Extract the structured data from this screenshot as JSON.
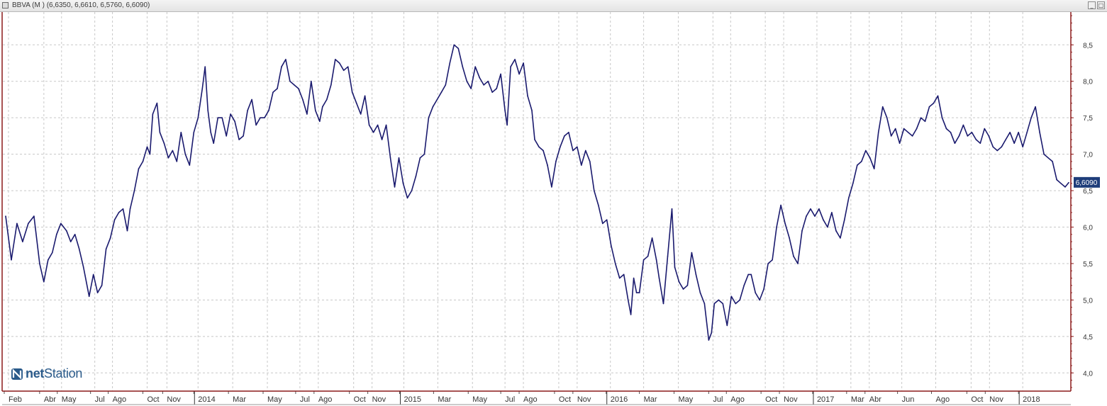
{
  "window": {
    "title": "BBVA (M ) (6,6350, 6,6610, 6,5760, 6,6090)",
    "minimize_glyph": "_",
    "restore_glyph": "□"
  },
  "logo": {
    "text_prefix": "net",
    "text_suffix": "Station"
  },
  "colors": {
    "line": "#1a1a6e",
    "grid": "#c8c8c8",
    "axis_border": "#8b1a1a",
    "price_badge": "#1e3d7a"
  },
  "chart_data": {
    "type": "line",
    "title": "BBVA (M ) (6,6350, 6,6610, 6,5760, 6,6090)",
    "xlabel": "",
    "ylabel": "",
    "ylim": [
      3.75,
      8.95
    ],
    "xlim": [
      0,
      1510
    ],
    "y_ticks": [
      4.0,
      4.5,
      5.0,
      5.5,
      6.0,
      6.5,
      7.0,
      7.5,
      8.0,
      8.5
    ],
    "y_tick_labels": [
      "4,0",
      "4,5",
      "5,0",
      "5,5",
      "6,0",
      "6,5",
      "7,0",
      "7,5",
      "8,0",
      "8,5"
    ],
    "x_ticks": [
      {
        "x": 8,
        "label": "Feb"
      },
      {
        "x": 58,
        "label": "Abr"
      },
      {
        "x": 83,
        "label": "May"
      },
      {
        "x": 130,
        "label": "Jul"
      },
      {
        "x": 155,
        "label": "Ago"
      },
      {
        "x": 204,
        "label": "Oct"
      },
      {
        "x": 232,
        "label": "Nov"
      },
      {
        "x": 276,
        "label": "2014"
      },
      {
        "x": 325,
        "label": "Mar"
      },
      {
        "x": 374,
        "label": "May"
      },
      {
        "x": 420,
        "label": "Jul"
      },
      {
        "x": 446,
        "label": "Ago"
      },
      {
        "x": 496,
        "label": "Oct"
      },
      {
        "x": 522,
        "label": "Nov"
      },
      {
        "x": 567,
        "label": "2015"
      },
      {
        "x": 615,
        "label": "Mar"
      },
      {
        "x": 664,
        "label": "May"
      },
      {
        "x": 710,
        "label": "Jul"
      },
      {
        "x": 736,
        "label": "Ago"
      },
      {
        "x": 786,
        "label": "Oct"
      },
      {
        "x": 812,
        "label": "Nov"
      },
      {
        "x": 859,
        "label": "2016"
      },
      {
        "x": 906,
        "label": "Mar"
      },
      {
        "x": 955,
        "label": "May"
      },
      {
        "x": 1004,
        "label": "Jul"
      },
      {
        "x": 1029,
        "label": "Ago"
      },
      {
        "x": 1078,
        "label": "Oct"
      },
      {
        "x": 1104,
        "label": "Nov"
      },
      {
        "x": 1151,
        "label": "2017"
      },
      {
        "x": 1199,
        "label": "Mar"
      },
      {
        "x": 1225,
        "label": "Abr"
      },
      {
        "x": 1271,
        "label": "Jun"
      },
      {
        "x": 1319,
        "label": "Ago"
      },
      {
        "x": 1369,
        "label": "Oct"
      },
      {
        "x": 1395,
        "label": "Nov"
      },
      {
        "x": 1442,
        "label": "2018"
      }
    ],
    "major_ticks": [
      276,
      567,
      859,
      1151,
      1442
    ],
    "last_price": 6.609,
    "last_price_label": "6,6090",
    "series": [
      {
        "points": [
          [
            4,
            6.15
          ],
          [
            12,
            5.55
          ],
          [
            20,
            6.05
          ],
          [
            28,
            5.8
          ],
          [
            36,
            6.05
          ],
          [
            44,
            6.15
          ],
          [
            52,
            5.5
          ],
          [
            58,
            5.25
          ],
          [
            64,
            5.55
          ],
          [
            70,
            5.65
          ],
          [
            76,
            5.9
          ],
          [
            82,
            6.05
          ],
          [
            90,
            5.95
          ],
          [
            96,
            5.8
          ],
          [
            102,
            5.9
          ],
          [
            108,
            5.7
          ],
          [
            114,
            5.45
          ],
          [
            122,
            5.05
          ],
          [
            128,
            5.35
          ],
          [
            134,
            5.1
          ],
          [
            140,
            5.2
          ],
          [
            146,
            5.7
          ],
          [
            152,
            5.85
          ],
          [
            158,
            6.1
          ],
          [
            164,
            6.2
          ],
          [
            170,
            6.25
          ],
          [
            176,
            5.95
          ],
          [
            180,
            6.25
          ],
          [
            186,
            6.5
          ],
          [
            192,
            6.8
          ],
          [
            198,
            6.9
          ],
          [
            204,
            7.1
          ],
          [
            208,
            7.0
          ],
          [
            212,
            7.55
          ],
          [
            218,
            7.7
          ],
          [
            222,
            7.3
          ],
          [
            228,
            7.15
          ],
          [
            234,
            6.95
          ],
          [
            240,
            7.05
          ],
          [
            246,
            6.9
          ],
          [
            252,
            7.3
          ],
          [
            258,
            7.0
          ],
          [
            264,
            6.85
          ],
          [
            270,
            7.3
          ],
          [
            276,
            7.5
          ],
          [
            282,
            7.9
          ],
          [
            286,
            8.2
          ],
          [
            290,
            7.6
          ],
          [
            294,
            7.3
          ],
          [
            298,
            7.15
          ],
          [
            304,
            7.5
          ],
          [
            310,
            7.5
          ],
          [
            316,
            7.25
          ],
          [
            322,
            7.55
          ],
          [
            328,
            7.45
          ],
          [
            334,
            7.2
          ],
          [
            340,
            7.25
          ],
          [
            346,
            7.6
          ],
          [
            352,
            7.75
          ],
          [
            358,
            7.4
          ],
          [
            364,
            7.5
          ],
          [
            370,
            7.5
          ],
          [
            376,
            7.6
          ],
          [
            382,
            7.85
          ],
          [
            388,
            7.9
          ],
          [
            394,
            8.2
          ],
          [
            400,
            8.3
          ],
          [
            406,
            8.0
          ],
          [
            412,
            7.95
          ],
          [
            418,
            7.9
          ],
          [
            424,
            7.75
          ],
          [
            430,
            7.55
          ],
          [
            436,
            8.0
          ],
          [
            442,
            7.6
          ],
          [
            448,
            7.45
          ],
          [
            452,
            7.65
          ],
          [
            458,
            7.75
          ],
          [
            464,
            7.95
          ],
          [
            470,
            8.3
          ],
          [
            476,
            8.25
          ],
          [
            482,
            8.15
          ],
          [
            488,
            8.2
          ],
          [
            494,
            7.85
          ],
          [
            500,
            7.7
          ],
          [
            506,
            7.55
          ],
          [
            512,
            7.8
          ],
          [
            518,
            7.4
          ],
          [
            524,
            7.3
          ],
          [
            530,
            7.4
          ],
          [
            536,
            7.2
          ],
          [
            542,
            7.4
          ],
          [
            548,
            6.95
          ],
          [
            554,
            6.55
          ],
          [
            560,
            6.95
          ],
          [
            566,
            6.6
          ],
          [
            572,
            6.4
          ],
          [
            578,
            6.5
          ],
          [
            584,
            6.7
          ],
          [
            590,
            6.95
          ],
          [
            596,
            7.0
          ],
          [
            602,
            7.5
          ],
          [
            608,
            7.65
          ],
          [
            614,
            7.75
          ],
          [
            620,
            7.85
          ],
          [
            626,
            7.95
          ],
          [
            632,
            8.25
          ],
          [
            638,
            8.5
          ],
          [
            644,
            8.45
          ],
          [
            650,
            8.2
          ],
          [
            656,
            8.0
          ],
          [
            662,
            7.9
          ],
          [
            668,
            8.2
          ],
          [
            674,
            8.05
          ],
          [
            680,
            7.95
          ],
          [
            686,
            8.0
          ],
          [
            692,
            7.85
          ],
          [
            698,
            7.9
          ],
          [
            704,
            8.1
          ],
          [
            710,
            7.6
          ],
          [
            713,
            7.4
          ],
          [
            718,
            8.2
          ],
          [
            724,
            8.3
          ],
          [
            730,
            8.1
          ],
          [
            736,
            8.25
          ],
          [
            742,
            7.8
          ],
          [
            748,
            7.6
          ],
          [
            752,
            7.2
          ],
          [
            758,
            7.1
          ],
          [
            764,
            7.05
          ],
          [
            770,
            6.85
          ],
          [
            776,
            6.55
          ],
          [
            782,
            6.9
          ],
          [
            788,
            7.1
          ],
          [
            794,
            7.25
          ],
          [
            800,
            7.3
          ],
          [
            806,
            7.05
          ],
          [
            812,
            7.1
          ],
          [
            818,
            6.85
          ],
          [
            824,
            7.05
          ],
          [
            830,
            6.9
          ],
          [
            836,
            6.5
          ],
          [
            842,
            6.3
          ],
          [
            848,
            6.05
          ],
          [
            854,
            6.1
          ],
          [
            860,
            5.75
          ],
          [
            866,
            5.5
          ],
          [
            872,
            5.3
          ],
          [
            878,
            5.35
          ],
          [
            884,
            5.0
          ],
          [
            888,
            4.8
          ],
          [
            892,
            5.3
          ],
          [
            896,
            5.1
          ],
          [
            900,
            5.1
          ],
          [
            906,
            5.55
          ],
          [
            912,
            5.6
          ],
          [
            918,
            5.85
          ],
          [
            924,
            5.55
          ],
          [
            928,
            5.3
          ],
          [
            934,
            4.95
          ],
          [
            940,
            5.6
          ],
          [
            946,
            6.25
          ],
          [
            950,
            5.45
          ],
          [
            956,
            5.25
          ],
          [
            962,
            5.15
          ],
          [
            968,
            5.2
          ],
          [
            974,
            5.65
          ],
          [
            980,
            5.35
          ],
          [
            986,
            5.1
          ],
          [
            992,
            4.95
          ],
          [
            998,
            4.45
          ],
          [
            1002,
            4.55
          ],
          [
            1006,
            4.95
          ],
          [
            1012,
            5.0
          ],
          [
            1018,
            4.95
          ],
          [
            1024,
            4.65
          ],
          [
            1030,
            5.05
          ],
          [
            1036,
            4.95
          ],
          [
            1042,
            5.0
          ],
          [
            1048,
            5.2
          ],
          [
            1054,
            5.35
          ],
          [
            1058,
            5.35
          ],
          [
            1064,
            5.1
          ],
          [
            1070,
            5.0
          ],
          [
            1076,
            5.15
          ],
          [
            1082,
            5.5
          ],
          [
            1088,
            5.55
          ],
          [
            1094,
            6.0
          ],
          [
            1100,
            6.3
          ],
          [
            1106,
            6.05
          ],
          [
            1112,
            5.85
          ],
          [
            1118,
            5.6
          ],
          [
            1124,
            5.5
          ],
          [
            1130,
            5.95
          ],
          [
            1136,
            6.15
          ],
          [
            1142,
            6.25
          ],
          [
            1148,
            6.15
          ],
          [
            1154,
            6.25
          ],
          [
            1160,
            6.1
          ],
          [
            1166,
            6.0
          ],
          [
            1172,
            6.2
          ],
          [
            1178,
            5.95
          ],
          [
            1184,
            5.85
          ],
          [
            1190,
            6.1
          ],
          [
            1196,
            6.4
          ],
          [
            1202,
            6.6
          ],
          [
            1208,
            6.85
          ],
          [
            1214,
            6.9
          ],
          [
            1220,
            7.05
          ],
          [
            1226,
            6.95
          ],
          [
            1232,
            6.8
          ],
          [
            1238,
            7.3
          ],
          [
            1244,
            7.65
          ],
          [
            1250,
            7.5
          ],
          [
            1256,
            7.25
          ],
          [
            1262,
            7.35
          ],
          [
            1268,
            7.15
          ],
          [
            1274,
            7.35
          ],
          [
            1280,
            7.3
          ],
          [
            1286,
            7.25
          ],
          [
            1292,
            7.35
          ],
          [
            1298,
            7.5
          ],
          [
            1304,
            7.45
          ],
          [
            1310,
            7.65
          ],
          [
            1316,
            7.7
          ],
          [
            1322,
            7.8
          ],
          [
            1328,
            7.5
          ],
          [
            1334,
            7.35
          ],
          [
            1340,
            7.3
          ],
          [
            1346,
            7.15
          ],
          [
            1352,
            7.25
          ],
          [
            1358,
            7.4
          ],
          [
            1364,
            7.25
          ],
          [
            1370,
            7.3
          ],
          [
            1376,
            7.2
          ],
          [
            1382,
            7.15
          ],
          [
            1388,
            7.35
          ],
          [
            1394,
            7.25
          ],
          [
            1400,
            7.1
          ],
          [
            1406,
            7.05
          ],
          [
            1412,
            7.1
          ],
          [
            1418,
            7.2
          ],
          [
            1424,
            7.3
          ],
          [
            1430,
            7.15
          ],
          [
            1436,
            7.3
          ],
          [
            1442,
            7.1
          ],
          [
            1448,
            7.3
          ],
          [
            1454,
            7.5
          ],
          [
            1460,
            7.65
          ],
          [
            1466,
            7.3
          ],
          [
            1472,
            7.0
          ],
          [
            1478,
            6.95
          ],
          [
            1484,
            6.9
          ],
          [
            1490,
            6.65
          ],
          [
            1496,
            6.6
          ],
          [
            1502,
            6.55
          ],
          [
            1507,
            6.61
          ]
        ]
      }
    ]
  }
}
